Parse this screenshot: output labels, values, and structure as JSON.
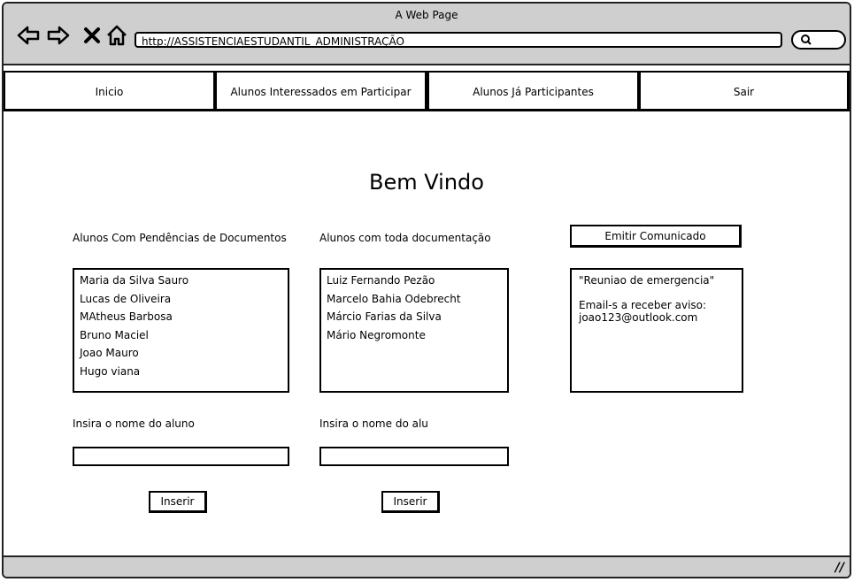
{
  "window": {
    "title": "A Web Page"
  },
  "browser": {
    "url": "http://ASSISTENCIAESTUDANTIL_ADMINISTRAÇÃO",
    "icons": [
      "back-arrow-icon",
      "forward-arrow-icon",
      "close-icon",
      "home-icon",
      "search-icon"
    ]
  },
  "tabs": [
    {
      "label": "Inicio"
    },
    {
      "label": "Alunos Interessados em Participar"
    },
    {
      "label": "Alunos Já Participantes"
    },
    {
      "label": "Sair"
    }
  ],
  "main": {
    "heading": "Bem Vindo",
    "pending": {
      "label": "Alunos Com Pendências de Documentos",
      "items": [
        "Maria da Silva Sauro",
        "Lucas de Oliveira",
        "MAtheus Barbosa",
        "Bruno Maciel",
        "Joao Mauro",
        "Hugo viana"
      ],
      "input_label": "Insira o nome do aluno",
      "button": "Inserir"
    },
    "complete": {
      "label": "Alunos com toda documentação",
      "items": [
        "Luiz Fernando Pezão",
        "Marcelo Bahia Odebrecht",
        "Márcio Farias da Silva",
        "Mário Negromonte"
      ],
      "input_label": "Insira o nome do alu",
      "button": "Inserir"
    },
    "notice": {
      "button": "Emitir Comunicado",
      "message": "\"Reuniao de emergencia\"",
      "recipients_label": "Email-s a receber aviso:",
      "recipient": "joao123@outlook.com"
    }
  }
}
